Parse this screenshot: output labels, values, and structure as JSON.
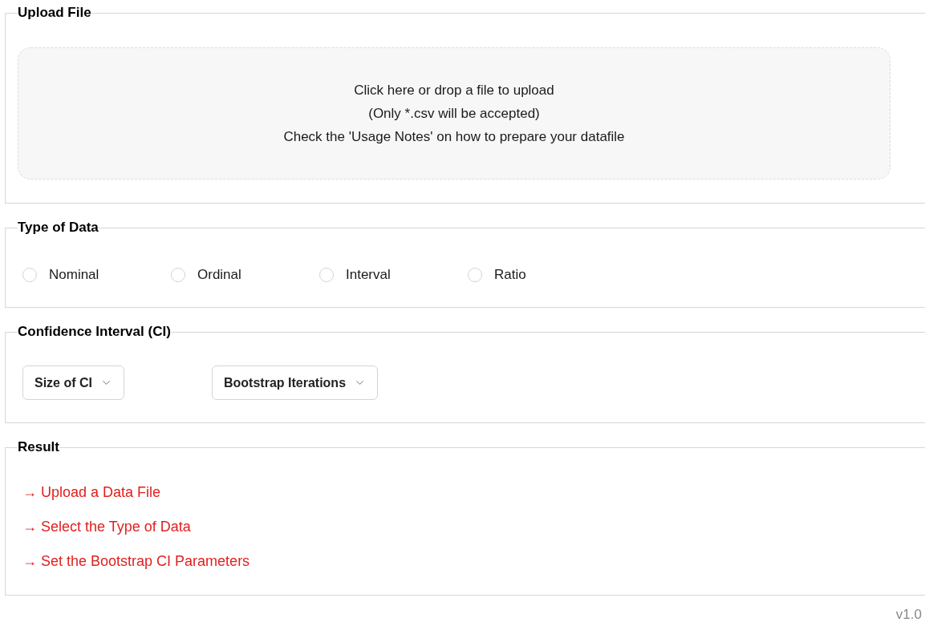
{
  "upload": {
    "title": "Upload File",
    "dropzone_lines": [
      "Click here or drop a file to upload",
      "(Only *.csv will be accepted)",
      "Check the 'Usage Notes' on how to prepare your datafile"
    ]
  },
  "data_type": {
    "title": "Type of Data",
    "options": [
      {
        "label": "Nominal",
        "selected": false
      },
      {
        "label": "Ordinal",
        "selected": false
      },
      {
        "label": "Interval",
        "selected": false
      },
      {
        "label": "Ratio",
        "selected": false
      }
    ]
  },
  "confidence_interval": {
    "title": "Confidence Interval (CI)",
    "selects": [
      {
        "label": "Size of CI"
      },
      {
        "label": "Bootstrap Iterations"
      }
    ]
  },
  "result": {
    "title": "Result",
    "messages": [
      "→ Upload a Data File",
      "→ Select the Type of Data",
      "→ Set the Bootstrap CI Parameters"
    ]
  },
  "version": "v1.0"
}
